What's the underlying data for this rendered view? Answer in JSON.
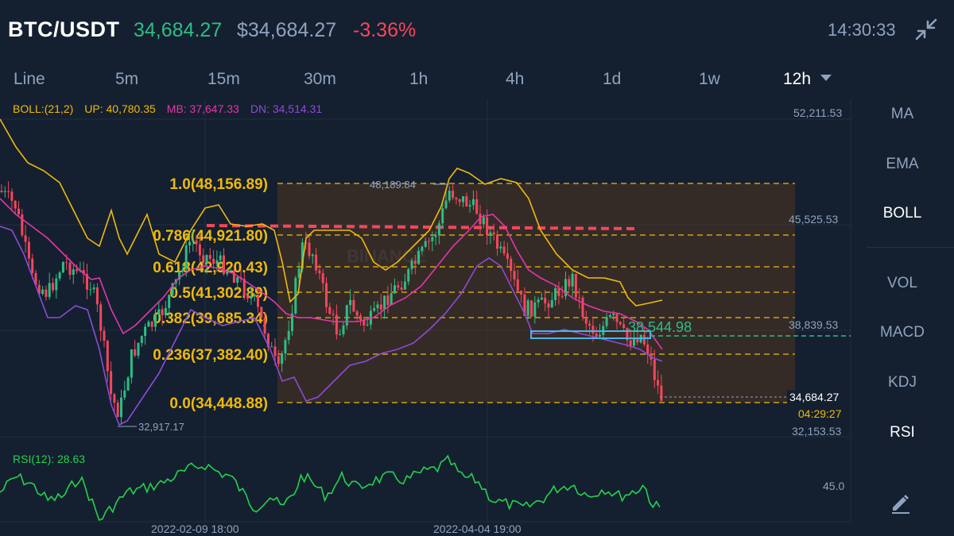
{
  "header": {
    "pair": "BTC/USDT",
    "last_price": "34,684.27",
    "usd_price": "$34,684.27",
    "change": "-3.36%",
    "clock": "14:30:33",
    "collapse_icon": "collapse-arrows-icon"
  },
  "timeframes": [
    "Line",
    "5m",
    "15m",
    "30m",
    "1h",
    "4h",
    "1d",
    "1w",
    "12h"
  ],
  "active_timeframe": "12h",
  "indicators": {
    "boll_label": "BOLL:(21,2)",
    "up": "UP: 40,780.35",
    "mb": "MB: 37,647.33",
    "dn": "DN: 34,514.31",
    "rsi_label": "RSI(12): 28.63"
  },
  "side_menu": [
    "MA",
    "EMA",
    "BOLL",
    "VOL",
    "MACD",
    "KDJ",
    "RSI"
  ],
  "side_menu_active": "BOLL",
  "pencil_icon": "pencil-draw-icon",
  "price_axis": {
    "labels": [
      "52,211.53",
      "45,525.53",
      "38,839.53",
      "32,153.53"
    ],
    "current_price": "34,684.27",
    "countdown": "04:29:27"
  },
  "fib_levels": [
    {
      "label": "1.0(48,156.89)",
      "price": 48156.89
    },
    {
      "label": "0.786(44,921.80)",
      "price": 44921.8
    },
    {
      "label": "0.618(42,920.43)",
      "price": 42920.43
    },
    {
      "label": "0.5(41,302.89)",
      "price": 41302.89
    },
    {
      "label": "0.382(39,685.34)",
      "price": 39685.34
    },
    {
      "label": "0.236(37,382.40)",
      "price": 37382.4
    },
    {
      "label": "0.0(34,448.88)",
      "price": 34448.88
    }
  ],
  "annotations": {
    "high_marker": "48,189.84",
    "low_marker": "32,917.17",
    "horizontal_line_price": "38,544.98",
    "rsi_level": "45.0"
  },
  "time_axis": [
    "2022-02-09 18:00",
    "2022-04-04 19:00"
  ],
  "watermark": "BINANCE",
  "colors": {
    "background": "#14202f",
    "up": "#2ebd85",
    "down": "#f6465d",
    "boll_up": "#f0b90b",
    "boll_mb": "#e535ab",
    "boll_dn": "#8d4bd6",
    "fib": "#f0b90b",
    "rsi": "#27d14f",
    "accent_cyan": "#4bb4e6"
  }
}
